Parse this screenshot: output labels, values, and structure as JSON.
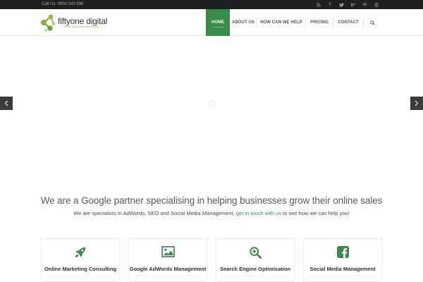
{
  "topbar": {
    "call_text": "Call Us: 0800 343 696",
    "socials": [
      {
        "icon": "rss-icon",
        "glyph": "))"
      },
      {
        "icon": "facebook-icon",
        "glyph": "f"
      },
      {
        "icon": "twitter-icon",
        "glyph": "t"
      },
      {
        "icon": "google-plus-icon",
        "glyph": "g+"
      },
      {
        "icon": "linkedin-icon",
        "glyph": "in"
      },
      {
        "icon": "skype-icon",
        "glyph": "S"
      }
    ]
  },
  "logo": {
    "name": "fiftyone digital",
    "tagline": "online marketing consultants"
  },
  "nav": {
    "items": [
      {
        "label": "HOME",
        "active": true
      },
      {
        "label": "ABOUT US",
        "active": false
      },
      {
        "label": "HOW CAN WE HELP",
        "active": false
      },
      {
        "label": "PRICING",
        "active": false
      },
      {
        "label": "CONTACT",
        "active": false
      }
    ]
  },
  "intro": {
    "headline": "We are a Google partner specialising in helping businesses grow their online sales",
    "sub_before": "We are specialists in AdWords, SEO and Social Media Management,",
    "sub_link": "get in touch with us",
    "sub_after": "to see how we can help you!"
  },
  "services": [
    {
      "title": "Online Marketing Consulting",
      "icon": "rocket-icon"
    },
    {
      "title": "Google AdWords Management",
      "icon": "picture-icon"
    },
    {
      "title": "Search Engine Optimisation",
      "icon": "zoom-in-icon"
    },
    {
      "title": "Social Media Management",
      "icon": "facebook-square-icon"
    }
  ],
  "colors": {
    "brand_green": "#3a8a4b",
    "logo_green": "#7fb53b",
    "topbar_bg": "#1f1f1f"
  }
}
